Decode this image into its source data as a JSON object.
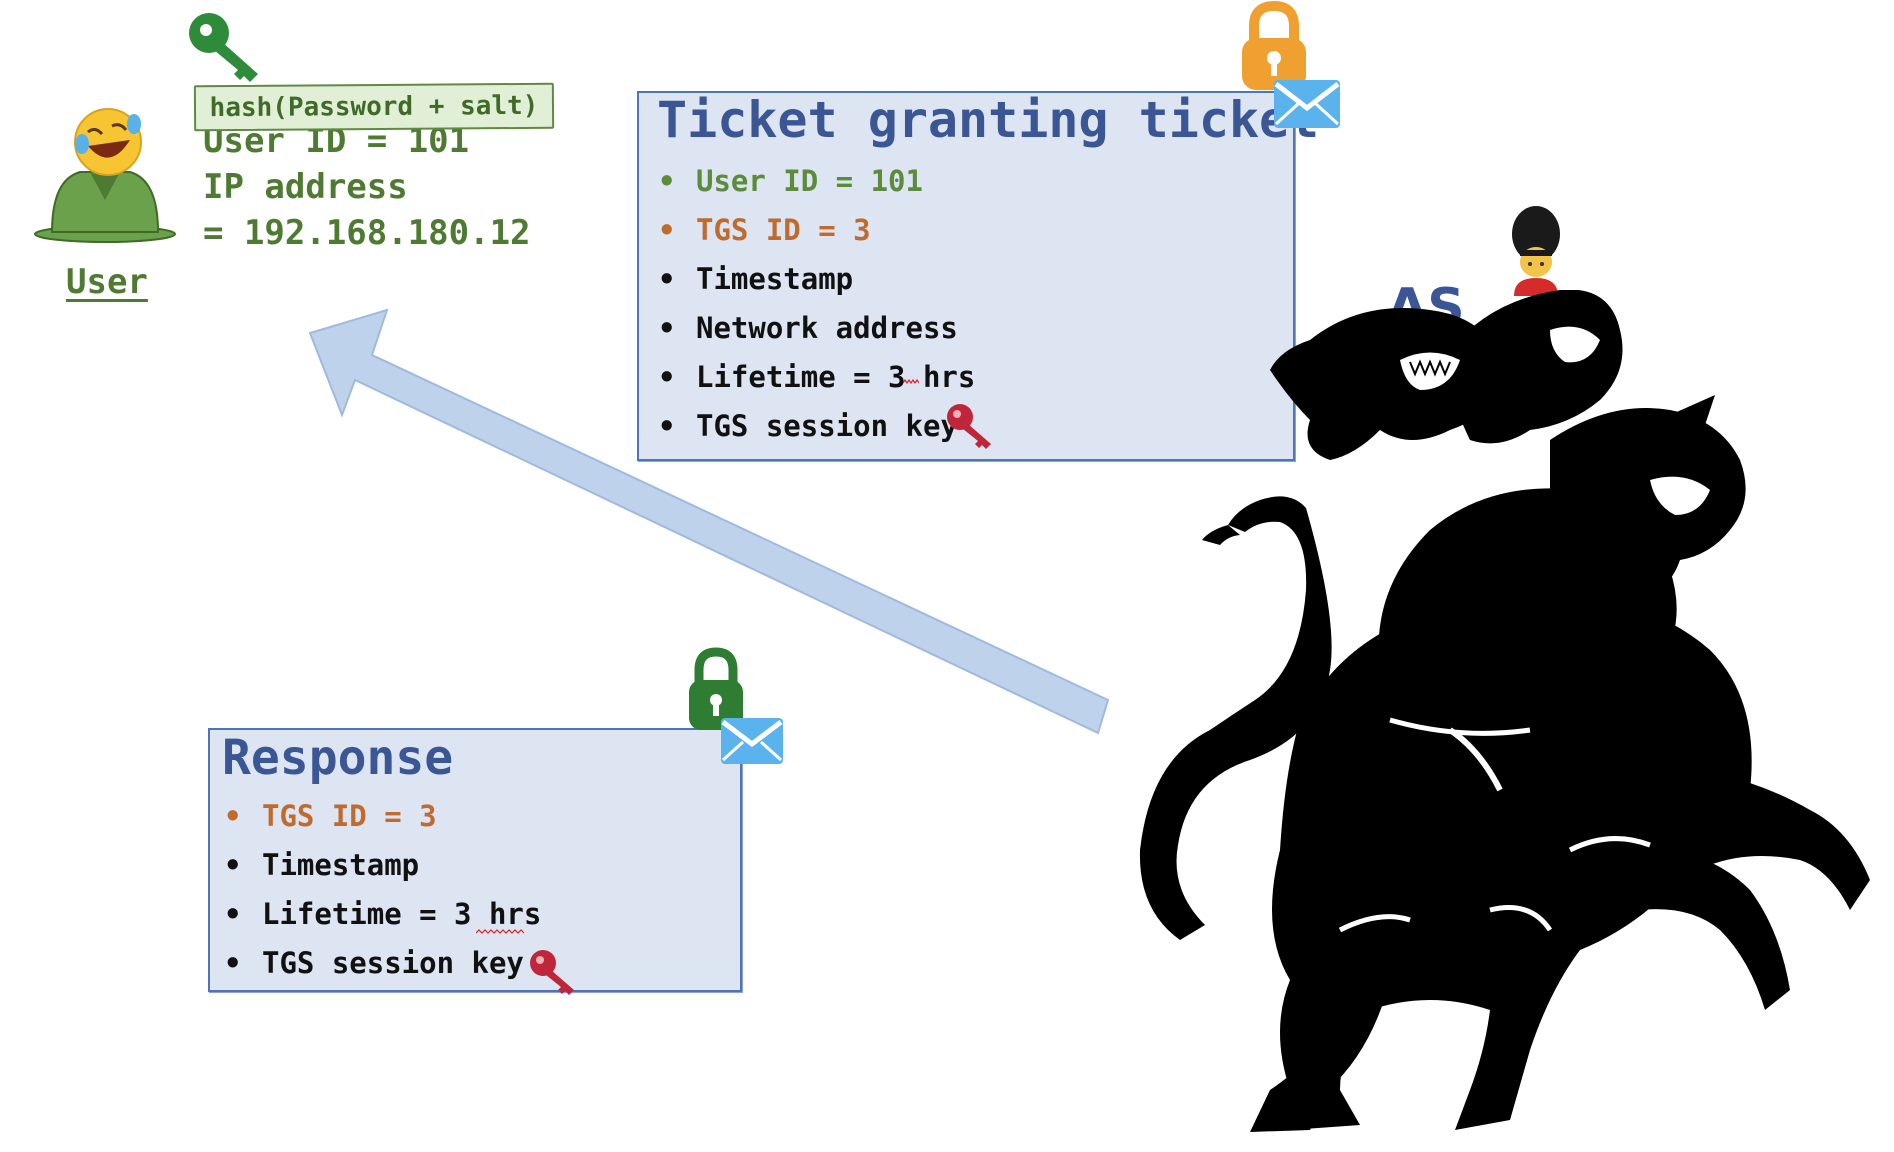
{
  "user": {
    "label": "User",
    "info": [
      "User ID = 101",
      "IP address",
      "= 192.168.180.12"
    ],
    "hash_label": "hash(Password + salt)"
  },
  "tgt": {
    "title": "Ticket granting ticket",
    "items": [
      "User ID = 101",
      "TGS ID = 3",
      "Timestamp",
      "Network address",
      "Lifetime = 3 hrs",
      "TGS session key"
    ]
  },
  "response": {
    "title": "Response",
    "items": [
      "TGS ID = 3",
      "Timestamp",
      "Lifetime = 3 hrs",
      "TGS session key"
    ]
  },
  "as": {
    "label": "AS"
  },
  "colors": {
    "green": "#5b8c3a",
    "orange": "#c06a2b",
    "blue_title": "#3b5694",
    "card_bg": "#dde4f2",
    "arrow": "#bcd0ea",
    "key_red": "#c0263a",
    "lock_orange": "#f0a030",
    "lock_green": "#2e7d32"
  },
  "icons": [
    "key-icon",
    "emoji-face-icon",
    "lock-icon",
    "envelope-icon",
    "guard-icon",
    "cerberus-illustration"
  ]
}
